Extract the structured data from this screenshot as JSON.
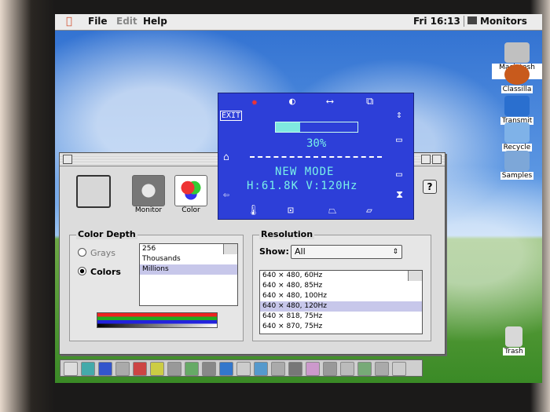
{
  "menubar": {
    "apple": "",
    "file": "File",
    "edit": "Edit",
    "help": "Help",
    "clock": "Fri 16:13",
    "app": "Monitors"
  },
  "desktop_icons": [
    {
      "label": "Macintosh HD",
      "color": "#c0c0c0"
    },
    {
      "label": "Classilla",
      "color": "#c85a1c"
    },
    {
      "label": "Transmit",
      "color": "#2a6fcf"
    },
    {
      "label": "Recycle",
      "color": "#7fb2e8"
    },
    {
      "label": "Samples",
      "color": "#7da7d8"
    },
    {
      "label": "Trash",
      "color": "#d8d8d8"
    }
  ],
  "window": {
    "icons": [
      {
        "label": "",
        "name": "monitor-main-icon"
      },
      {
        "label": "Monitor",
        "name": "brightness-icon"
      },
      {
        "label": "Color",
        "name": "color-wheel-icon"
      }
    ],
    "help": "?",
    "color_depth": {
      "title": "Color Depth",
      "options": [
        "Grays",
        "Colors"
      ],
      "selected": "Colors",
      "list": [
        "256",
        "Thousands",
        "Millions"
      ],
      "list_selected": "Millions"
    },
    "resolution": {
      "title": "Resolution",
      "show_label": "Show:",
      "show_value": "All",
      "list": [
        "640 × 480, 60Hz",
        "640 × 480, 85Hz",
        "640 × 480, 100Hz",
        "640 × 480, 120Hz",
        "640 × 818, 75Hz",
        "640 × 870, 75Hz"
      ],
      "selected": "640 × 480, 120Hz"
    }
  },
  "osd": {
    "exit": "EXIT",
    "percent_text": "30%",
    "percent_value": 0.3,
    "mode": "NEW MODE",
    "frequency": "H:61.8K V:120Hz",
    "bar_color": "#7fe8e0",
    "bg_color": "#2d3fd8",
    "text_color": "#79f0e9"
  },
  "control_strip": {
    "cells": 20
  }
}
